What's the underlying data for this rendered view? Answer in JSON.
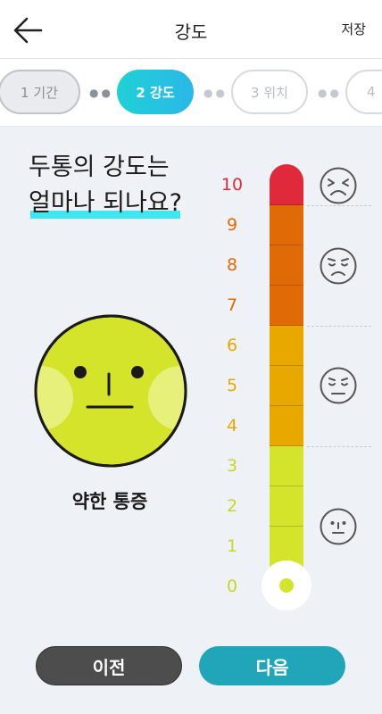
{
  "header": {
    "title": "강도",
    "save_label": "저장"
  },
  "steps": [
    {
      "label": "1 기간",
      "state": "done"
    },
    {
      "label": "2 강도",
      "state": "active"
    },
    {
      "label": "3 위치",
      "state": "pending"
    },
    {
      "label": "4",
      "state": "pending"
    }
  ],
  "question": {
    "line1": "두통의 강도는",
    "line2": "얼마나 되나요?"
  },
  "selected": {
    "level": 0,
    "label": "약한 통증"
  },
  "scale": {
    "numbers": [
      "10",
      "9",
      "8",
      "7",
      "6",
      "5",
      "4",
      "3",
      "2",
      "1",
      "0"
    ],
    "colors": {
      "severe": "#e0293a",
      "high": "#e06b06",
      "medium": "#e8a800",
      "low": "#d4e42b",
      "face": "#d4e42b",
      "cheek": "#e6f07a"
    }
  },
  "faces": [
    {
      "icon": "severe-pain-face-icon"
    },
    {
      "icon": "high-pain-face-icon"
    },
    {
      "icon": "moderate-pain-face-icon"
    },
    {
      "icon": "mild-pain-face-icon"
    }
  ],
  "buttons": {
    "prev_label": "이전",
    "next_label": "다음"
  }
}
